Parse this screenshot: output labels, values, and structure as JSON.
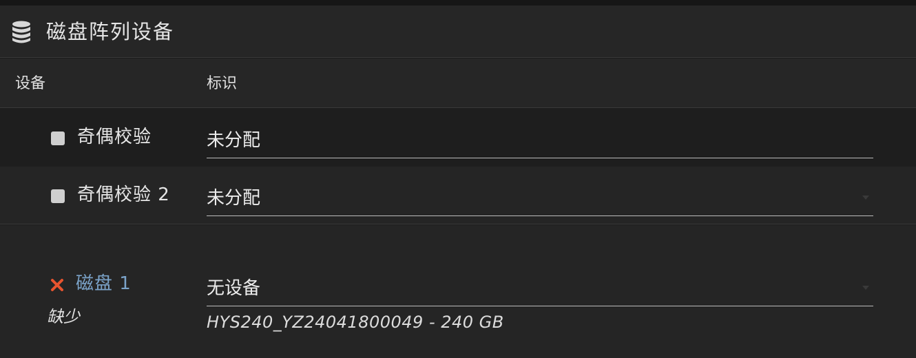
{
  "header": {
    "title": "磁盘阵列设备",
    "icon": "database-icon"
  },
  "columns": {
    "device": "设备",
    "identification": "标识"
  },
  "rows": [
    {
      "name": "奇偶校验",
      "value": "未分配",
      "status_icon": "square-icon",
      "status_color": "#cfcfcf"
    },
    {
      "name": "奇偶校验 2",
      "value": "未分配",
      "status_icon": "square-icon",
      "status_color": "#cfcfcf"
    },
    {
      "name": "磁盘 1",
      "value": "无设备",
      "status_icon": "close-icon",
      "status_color": "#e8542f",
      "status_text": "缺少",
      "serial": "HYS240_YZ24041800049 - 240 GB"
    }
  ],
  "colors": {
    "background": "#1c1c1c",
    "header_bg": "#262626",
    "disk_link": "#7ba3c9",
    "error": "#e8542f"
  }
}
